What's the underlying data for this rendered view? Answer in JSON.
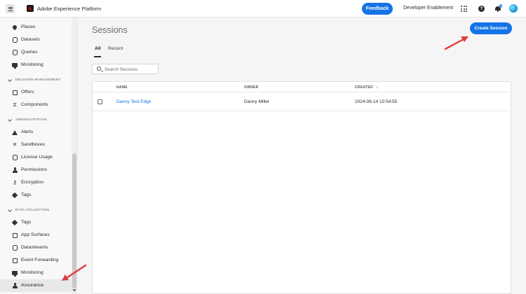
{
  "header": {
    "app_title": "Adobe Experience Platform",
    "feedback_label": "Feedback",
    "org_name": "Developer Enablement",
    "help_label": "?"
  },
  "sidebar": {
    "items_top": [
      {
        "label": "Places",
        "icon": "pin-icon"
      },
      {
        "label": "Datasets",
        "icon": "database-icon"
      },
      {
        "label": "Queries",
        "icon": "database-icon"
      },
      {
        "label": "Monitoring",
        "icon": "monitor-icon"
      }
    ],
    "section_decision": "DECISION MANAGEMENT",
    "items_decision": [
      {
        "label": "Offers",
        "icon": "offers-icon"
      },
      {
        "label": "Components",
        "icon": "components-icon"
      }
    ],
    "section_admin": "ADMINISTRATION",
    "items_admin": [
      {
        "label": "Alerts",
        "icon": "alert-icon"
      },
      {
        "label": "Sandboxes",
        "icon": "tools-icon"
      },
      {
        "label": "License Usage",
        "icon": "license-icon"
      },
      {
        "label": "Permissions",
        "icon": "person-icon"
      },
      {
        "label": "Encryption",
        "icon": "key-icon"
      },
      {
        "label": "Tags",
        "icon": "tag-icon"
      }
    ],
    "section_data": "DATA COLLECTION",
    "items_data": [
      {
        "label": "Tags",
        "icon": "tag-icon"
      },
      {
        "label": "App Surfaces",
        "icon": "app-surfaces-icon"
      },
      {
        "label": "Datastreams",
        "icon": "datastreams-icon"
      },
      {
        "label": "Event Forwarding",
        "icon": "event-forwarding-icon"
      },
      {
        "label": "Monitoring",
        "icon": "monitor-icon"
      },
      {
        "label": "Assurance",
        "icon": "assurance-icon",
        "active": true
      }
    ]
  },
  "main": {
    "title": "Sessions",
    "create_label": "Create Session",
    "tabs": [
      "All",
      "Recent"
    ],
    "search_placeholder": "Search Sessions",
    "columns": [
      "NAME",
      "OWNER",
      "CREATED"
    ],
    "rows": [
      {
        "name": "Danny Test Edge",
        "owner": "Danny Miller",
        "created": "2024-06-14 10:54:55"
      }
    ]
  },
  "colors": {
    "accent": "#1473e6",
    "annotation_arrow": "#e03b3b"
  }
}
